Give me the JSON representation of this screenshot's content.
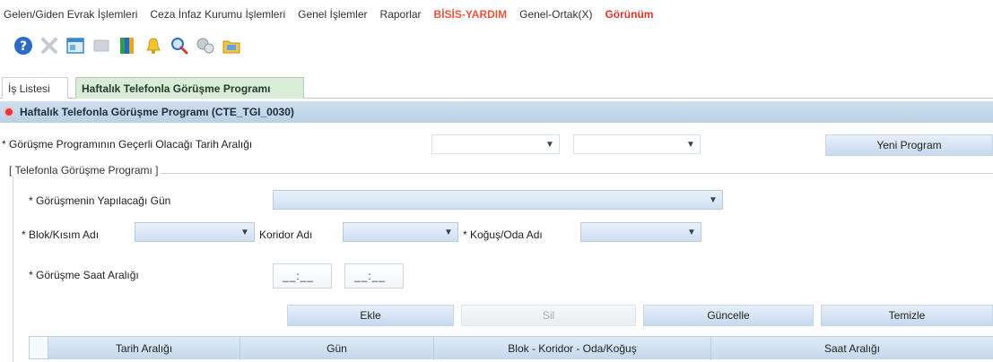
{
  "menu": [
    {
      "label": "Gelen/Giden Evrak İşlemleri",
      "style": "normal"
    },
    {
      "label": "Ceza İnfaz Kurumu İşlemleri",
      "style": "normal"
    },
    {
      "label": "Genel İşlemler",
      "style": "normal"
    },
    {
      "label": "Raporlar",
      "style": "normal"
    },
    {
      "label": "BİSİS-YARDIM",
      "style": "special"
    },
    {
      "label": "Genel-Ortak(X)",
      "style": "normal"
    },
    {
      "label": "Görünüm",
      "style": "red"
    }
  ],
  "toolbar": {
    "icons": [
      "help-icon",
      "delete-icon",
      "window-icon",
      "grid-icon",
      "book-icon",
      "bell-icon",
      "search-icon",
      "tools-icon",
      "folder-icon"
    ]
  },
  "tabs": {
    "tab1": "İş Listesi",
    "tab2": "Haftalık Telefonla Görüşme Programı"
  },
  "panel": {
    "title": "Haftalık Telefonla Görüşme Programı (CTE_TGI_0030)"
  },
  "form": {
    "date_range_label": "* Görüşme Programının Geçerli Olacağı Tarih Aralığı",
    "new_program_button": "Yeni Program",
    "fieldset_legend": "[ Telefonla Görüşme Programı ]",
    "day_label": "* Görüşmenin Yapılacağı Gün",
    "block_label": "* Blok/Kısım Adı",
    "corridor_label": "Koridor Adı",
    "ward_label": "* Koğuş/Oda Adı",
    "time_range_label": "* Görüşme Saat Aralığı",
    "time_start": "__:__",
    "time_end": "__:__"
  },
  "actions": {
    "add": "Ekle",
    "delete": "Sil",
    "update": "Güncelle",
    "clear": "Temizle"
  },
  "table": {
    "columns": [
      "Tarih Aralığı",
      "Gün",
      "Blok - Koridor - Oda/Koğuş",
      "Saat Aralığı"
    ]
  }
}
